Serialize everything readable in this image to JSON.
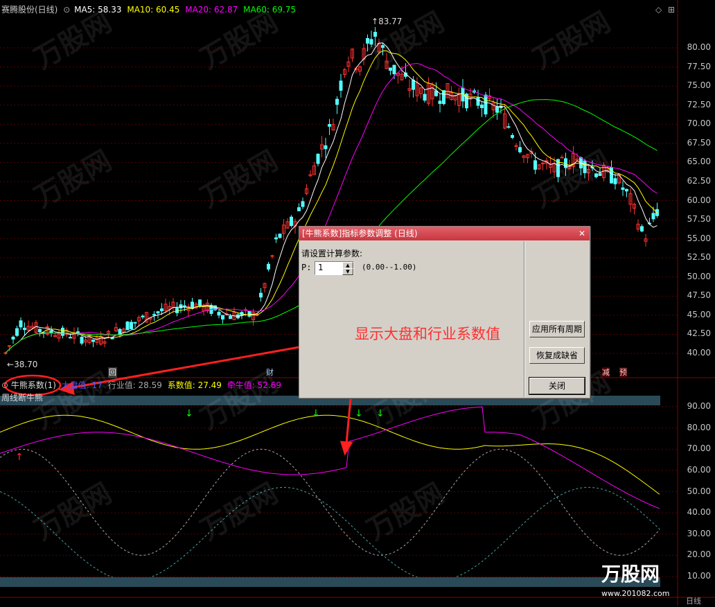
{
  "top_bar": {
    "stock_name": "赛腾股份(日线)",
    "ma5": "MA5: 58.33",
    "ma10": "MA10: 60.45",
    "ma20": "MA20: 62.87",
    "ma60": "MA60: 69.75"
  },
  "price_panel": {
    "high_label": "83.77",
    "low_label": "38.70",
    "y_ticks": [
      "80.00",
      "77.50",
      "75.00",
      "72.50",
      "70.00",
      "67.50",
      "65.00",
      "62.50",
      "60.00",
      "57.50",
      "55.00",
      "52.50",
      "50.00",
      "47.50",
      "45.00",
      "42.50",
      "40.00"
    ],
    "markers": {
      "hui": "回",
      "cai": "财",
      "jian": "减",
      "yu": "预"
    }
  },
  "indicator_bar": {
    "name": "牛熊系数(1)",
    "dapan": "大盘值: 17",
    "hangye": "行业值: 28.59",
    "xishu": "系数值: 27.49",
    "qianniu": "牵牛值: 52.69",
    "subtitle": "周线断牛熊"
  },
  "indicator_panel": {
    "y_ticks": [
      "90.00",
      "80.00",
      "70.00",
      "60.00",
      "50.00",
      "40.00",
      "30.00",
      "20.00",
      "10.00"
    ]
  },
  "dialog": {
    "title": "[牛熊系数]指标参数调整 (日线)",
    "prompt": "请设置计算参数:",
    "param_label": "P:",
    "param_value": "1",
    "range": "(0.00--1.00)",
    "btn_apply_all": "应用所有周期",
    "btn_restore": "恢复成缺省",
    "btn_close": "关闭"
  },
  "annotation": "显示大盘和行业系数值",
  "watermark": "万股网 www.201082.com",
  "bottom_bar": {
    "label": "日线"
  },
  "colors": {
    "candle_up": "#ff3232",
    "candle_down": "#54ffff",
    "ma5": "#ffffff",
    "ma10": "#ffff00",
    "ma20": "#ff00ff",
    "ma60": "#00ff00",
    "grid": "#7a0000"
  }
}
